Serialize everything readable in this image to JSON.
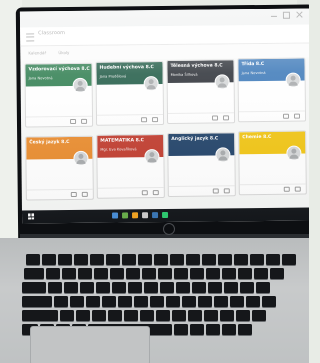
{
  "screen": {
    "app_title": "Classroom",
    "subbar": [
      "Kalendář",
      "Úkoly"
    ],
    "window_controls": [
      "minimize",
      "maximize",
      "close"
    ]
  },
  "cards": [
    {
      "title": "Vzdorovací výchova 8.C",
      "subtitle": "Jana Novotná",
      "color": "#2e7d4f"
    },
    {
      "title": "Hudební výchova 8.C",
      "subtitle": "Jana Prodělová",
      "color": "#1f5a45"
    },
    {
      "title": "Tělesná výchova 8.C",
      "subtitle": "Monika Šilhová",
      "color": "#2b2f36"
    },
    {
      "title": "Třída 8.C",
      "subtitle": "Jana Novotná",
      "color": "#3b78b8"
    },
    {
      "title": "Český jazyk 8.C",
      "subtitle": "",
      "color": "#e98a2a"
    },
    {
      "title": "MATEMATIKA 8.C",
      "subtitle": "Mgr. Eva Kovaříková",
      "color": "#c0392b"
    },
    {
      "title": "Anglický jazyk 8.C",
      "subtitle": "",
      "color": "#1d3f66"
    },
    {
      "title": "Chemie 8.C",
      "subtitle": "",
      "color": "#f1c40f"
    }
  ],
  "taskbar": {
    "tray_text": "",
    "icon_colors": [
      "#4a90d9",
      "#6ab04c",
      "#f5a623",
      "#d0d0d0",
      "#3b78b8",
      "#2ecc71"
    ]
  },
  "laptop": {
    "brand_logo": "hp-logo"
  }
}
